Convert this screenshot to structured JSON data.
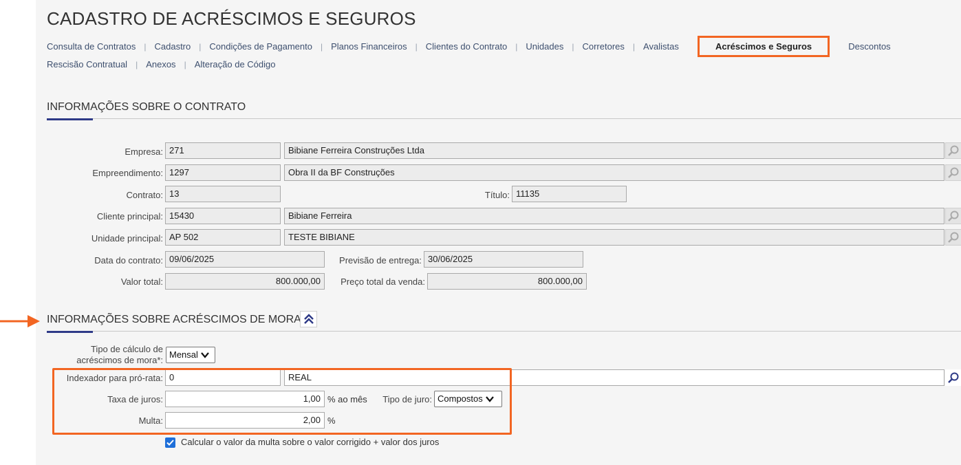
{
  "title": "CADASTRO DE ACRÉSCIMOS E SEGUROS",
  "tabs_row1": [
    "Consulta de Contratos",
    "Cadastro",
    "Condições de Pagamento",
    "Planos Financeiros",
    "Clientes do Contrato",
    "Unidades",
    "Corretores",
    "Avalistas",
    "Acréscimos e Seguros",
    "Descontos"
  ],
  "tabs_row2": [
    "Rescisão Contratual",
    "Anexos",
    "Alteração de Código"
  ],
  "active_tab": "Acréscimos e Seguros",
  "contract_section": {
    "title": "INFORMAÇÕES SOBRE O CONTRATO",
    "empresa": {
      "label": "Empresa:",
      "code": "271",
      "name": "Bibiane Ferreira Construções Ltda"
    },
    "empreendimento": {
      "label": "Empreendimento:",
      "code": "1297",
      "name": "Obra II da BF Construções"
    },
    "contrato": {
      "label": "Contrato:",
      "value": "13"
    },
    "titulo": {
      "label": "Título:",
      "value": "11135"
    },
    "cliente": {
      "label": "Cliente principal:",
      "code": "15430",
      "name": "Bibiane Ferreira"
    },
    "unidade": {
      "label": "Unidade principal:",
      "code": "AP 502",
      "name": "TESTE BIBIANE"
    },
    "data_contrato": {
      "label": "Data do contrato:",
      "value": "09/06/2025"
    },
    "previsao": {
      "label": "Previsão de entrega:",
      "value": "30/06/2025"
    },
    "valor_total": {
      "label": "Valor total:",
      "value": "800.000,00"
    },
    "preco_total": {
      "label": "Preço total da venda:",
      "value": "800.000,00"
    }
  },
  "mora_section": {
    "title": "INFORMAÇÕES SOBRE ACRÉSCIMOS DE MORA",
    "tipo_calculo": {
      "label_line1": "Tipo de cálculo de",
      "label_line2": "acréscimos de mora*:",
      "value": "Mensal"
    },
    "indexador": {
      "label": "Indexador para pró-rata:",
      "code": "0",
      "name": "REAL"
    },
    "taxa": {
      "label": "Taxa de juros:",
      "value": "1,00",
      "unit": "% ao mês"
    },
    "tipo_juro": {
      "label": "Tipo de juro:",
      "value": "Compostos"
    },
    "multa": {
      "label": "Multa:",
      "value": "2,00",
      "unit": "%"
    },
    "calc_checkbox": {
      "label": "Calcular o valor da multa sobre o valor corrigido + valor dos juros",
      "checked": true
    }
  },
  "colors": {
    "highlight": "#f26522",
    "accent": "#2e3a87",
    "checkbox": "#1e6fd9"
  },
  "icons": {
    "lookup": "search-icon",
    "collapse": "double-chevron-up-icon",
    "arrow": "arrow-right-icon"
  }
}
